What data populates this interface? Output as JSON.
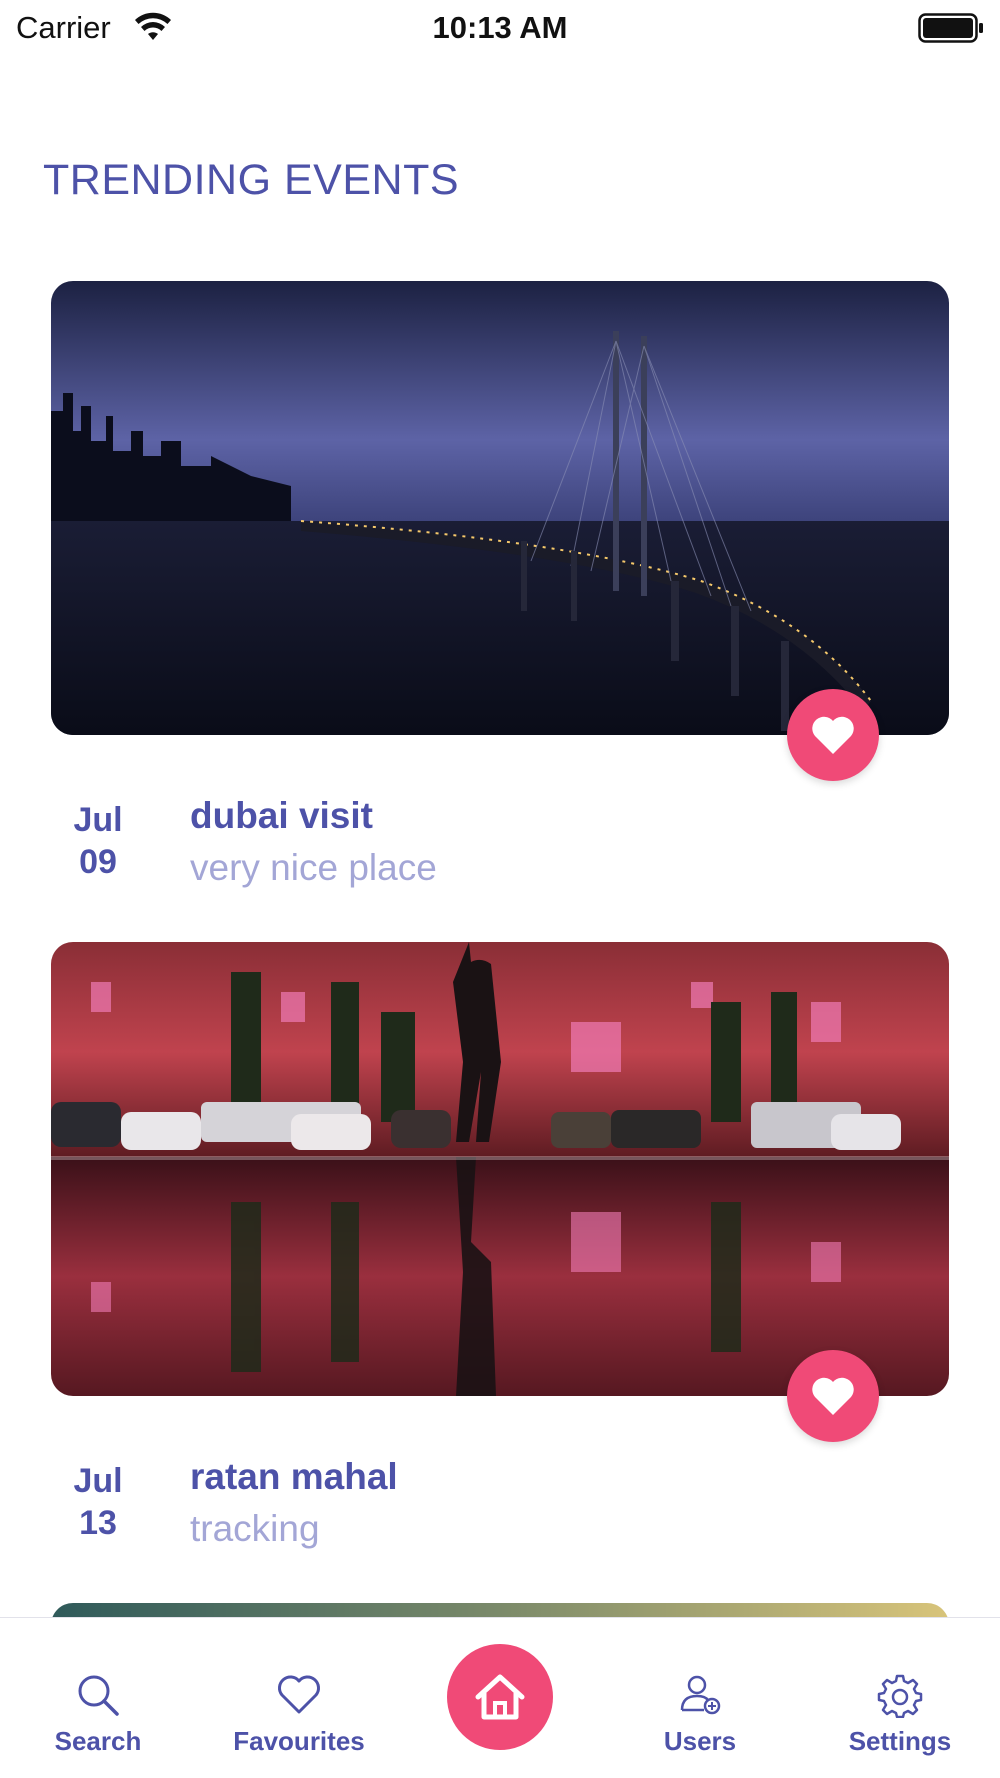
{
  "status_bar": {
    "carrier": "Carrier",
    "time": "10:13 AM"
  },
  "page": {
    "title": "TRENDING EVENTS"
  },
  "events": [
    {
      "month": "Jul",
      "day": "09",
      "title": "dubai visit",
      "subtitle": "very nice place",
      "photo_icon": "city-bridge-night-photo",
      "favorite_icon": "heart-icon"
    },
    {
      "month": "Jul",
      "day": "13",
      "title": "ratan mahal",
      "subtitle": "tracking",
      "photo_icon": "rainy-street-reflection-photo",
      "favorite_icon": "heart-icon"
    }
  ],
  "tab_bar": {
    "search_label": "Search",
    "favourites_label": "Favourites",
    "users_label": "Users",
    "settings_label": "Settings",
    "home_icon": "home-icon"
  },
  "colors": {
    "primary": "#4d52a8",
    "accent": "#f04a77",
    "muted_text": "#a3a6d6"
  }
}
